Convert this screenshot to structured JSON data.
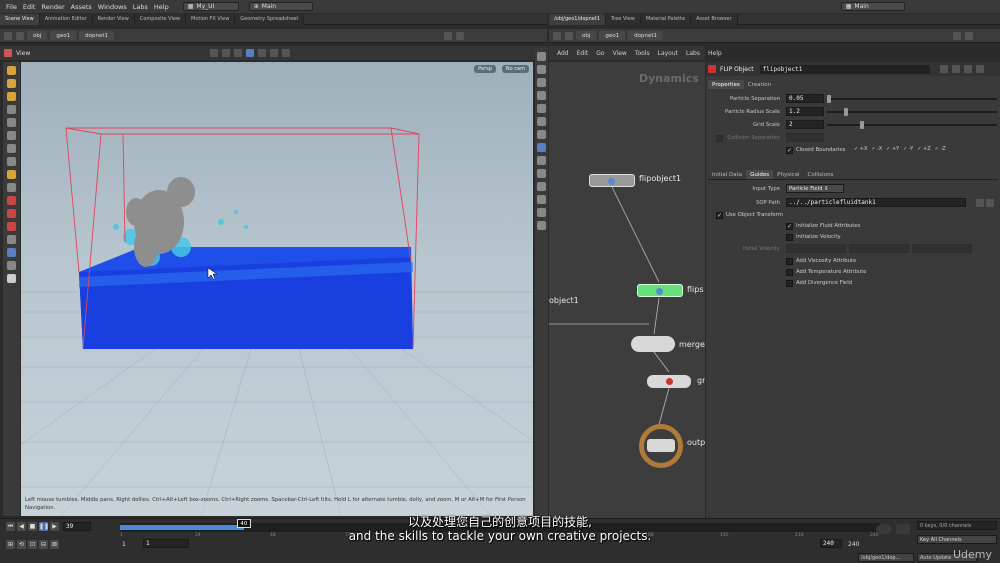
{
  "menu": [
    "File",
    "Edit",
    "Render",
    "Assets",
    "Windows",
    "Labs",
    "Help"
  ],
  "shelf_set": "My_UI",
  "desktop_left": "Main",
  "desktop_right": "Main",
  "left_tabs": [
    "Scene View",
    "Animation Editor",
    "Render View",
    "Composite View",
    "Motion FX View",
    "Geometry Spreadsheet"
  ],
  "right_tabs": [
    "/obj/geo1/dopnet1",
    "Tree View",
    "Material Palette",
    "Asset Browser"
  ],
  "left_path": [
    "obj",
    "geo1",
    "dopnet1"
  ],
  "right_path": [
    "obj",
    "geo1",
    "dopnet1"
  ],
  "viewport": {
    "label": "View",
    "persp": "Persp",
    "cam": "No cam",
    "hint": "Left mouse tumbles. Middle pans. Right dollies. Ctrl+Alt+Left box-zooms. Ctrl+Right zooms. Spacebar-Ctrl-Left tilts. Hold L for alternate tumble, dolly, and zoom.     M or Alt+M for First Person Navigation."
  },
  "network": {
    "menu": [
      "Add",
      "Edit",
      "Go",
      "View",
      "Tools",
      "Layout",
      "Labs",
      "Help"
    ],
    "watermark": "Dynamics",
    "nodes": [
      "flipobject1",
      "flips",
      "merge",
      "gr",
      "outp",
      "object1"
    ]
  },
  "params": {
    "node_type": "FLIP Object",
    "node_name": "flipobject1",
    "top_tabs": [
      "Properties",
      "Creation"
    ],
    "particle_separation_label": "Particle Separation",
    "particle_separation": "0.05",
    "particle_separation_frac": 0.0,
    "particle_radius_label": "Particle Radius Scale",
    "particle_radius": "1.2",
    "particle_radius_frac": 0.1,
    "grid_scale_label": "Grid Scale",
    "grid_scale": "2",
    "grid_scale_frac": 0.2,
    "collision_sep_label": "Collision Separation",
    "closed_boundaries_label": "Closed Boundaries",
    "boundaries": [
      "+X",
      "-X",
      "+Y",
      "-Y",
      "+Z",
      "-Z"
    ],
    "sub_tabs": [
      "Initial Data",
      "Guides",
      "Physical",
      "Collisions"
    ],
    "input_type_label": "Input Type",
    "input_type": "Particle Field",
    "sop_path_label": "SOP Path",
    "sop_path": "../../particlefluidtank1",
    "use_object_transform": "Use Object Transform",
    "init_fluid_attrs": "Initialize Fluid Attributes",
    "init_velocity": "Initialize Velocity",
    "initial_velocity_label": "Initial Velocity",
    "add_viscosity": "Add Viscosity Attribute",
    "add_temperature": "Add Temperature Attribute",
    "add_divergence": "Add Divergence Field"
  },
  "timeline": {
    "current_frame": "40",
    "start_frame_field": "39",
    "range_start": "1",
    "range_start2": "1",
    "range_end": "240",
    "range_end2": "240",
    "ticks": [
      "1",
      "24",
      "48",
      "72",
      "96",
      "120",
      "144",
      "168",
      "192",
      "216",
      "240"
    ],
    "keys": "0 keys, 0/0 channels",
    "key_all": "Key All Channels",
    "path": "/obj/geo1/dop...",
    "auto_update": "Auto Update",
    "playhead_frac": 0.163
  },
  "subtitle": {
    "chinese": "以及处理您自己的创意项目的技能,",
    "english": "and the skills to tackle your own creative projects."
  },
  "brand": "Udemy",
  "colors": {
    "water": "#1a3fe0",
    "bbox": "#e0445c",
    "flip_node": "#66e07a",
    "output_ring": "#b07a3a",
    "playbar": "#4a8ad8"
  }
}
